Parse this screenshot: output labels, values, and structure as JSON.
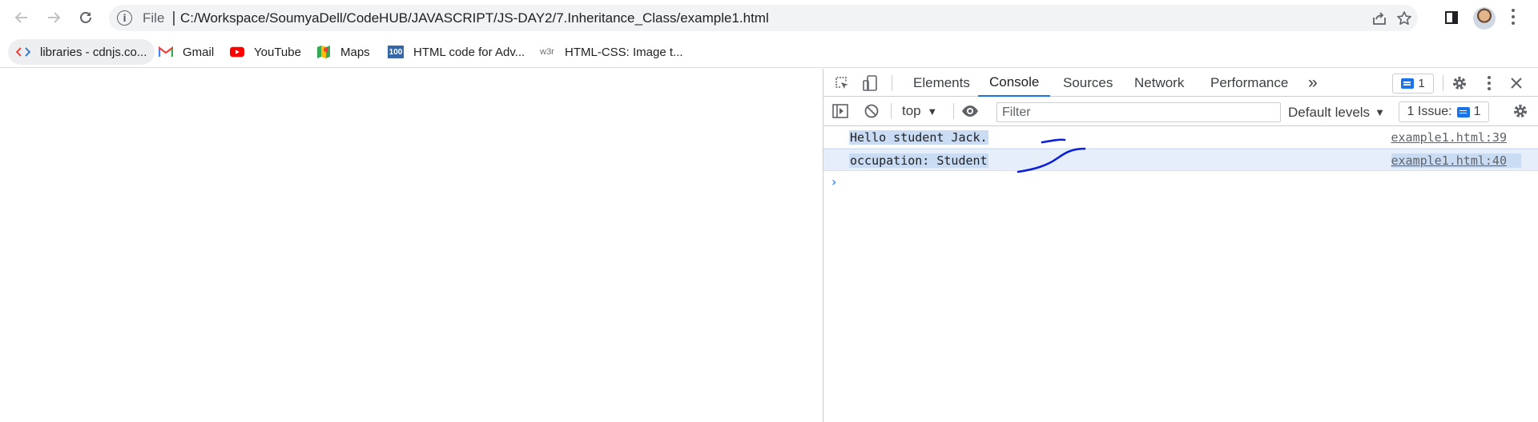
{
  "browser": {
    "omnibox": {
      "scheme_label": "File",
      "url": "C:/Workspace/SoumyaDell/CodeHUB/JAVASCRIPT/JS-DAY2/7.Inheritance_Class/example1.html"
    },
    "icons": {
      "back": "arrow-left-icon",
      "forward": "arrow-right-icon",
      "reload": "reload-icon",
      "info": "info-icon",
      "share": "share-icon",
      "bookmark": "star-icon",
      "side_panel": "side-panel-icon",
      "profile": "avatar",
      "menu": "kebab-menu-icon"
    }
  },
  "bookmarks": [
    {
      "label": "libraries - cdnjs.co...",
      "icon": "cdnjs-icon",
      "active": true
    },
    {
      "label": "Gmail",
      "icon": "gmail-icon"
    },
    {
      "label": "YouTube",
      "icon": "youtube-icon"
    },
    {
      "label": "Maps",
      "icon": "maps-icon"
    },
    {
      "label": "HTML code for Adv...",
      "icon": "100-icon",
      "icon_text": "100"
    },
    {
      "label": "HTML-CSS: Image t...",
      "icon": "w3r-icon",
      "icon_text": "w3r"
    }
  ],
  "devtools": {
    "tabs": [
      "Elements",
      "Console",
      "Sources",
      "Network",
      "Performance"
    ],
    "selected_tab": "Console",
    "more_tabs_glyph": "»",
    "message_count": "1",
    "filter_bar": {
      "context": "top",
      "filter_placeholder": "Filter",
      "levels": "Default levels",
      "issues_label": "1 Issue:",
      "issues_count": "1"
    },
    "console": {
      "logs": [
        {
          "message": "Hello student Jack.",
          "source": "example1.html:39"
        },
        {
          "message": "occupation: Student",
          "source": "example1.html:40"
        }
      ],
      "prompt_glyph": "›"
    }
  },
  "colors": {
    "accent": "#1a73e8",
    "selection": "#c9dcf3",
    "ink_annotation": "#0a1edc"
  }
}
